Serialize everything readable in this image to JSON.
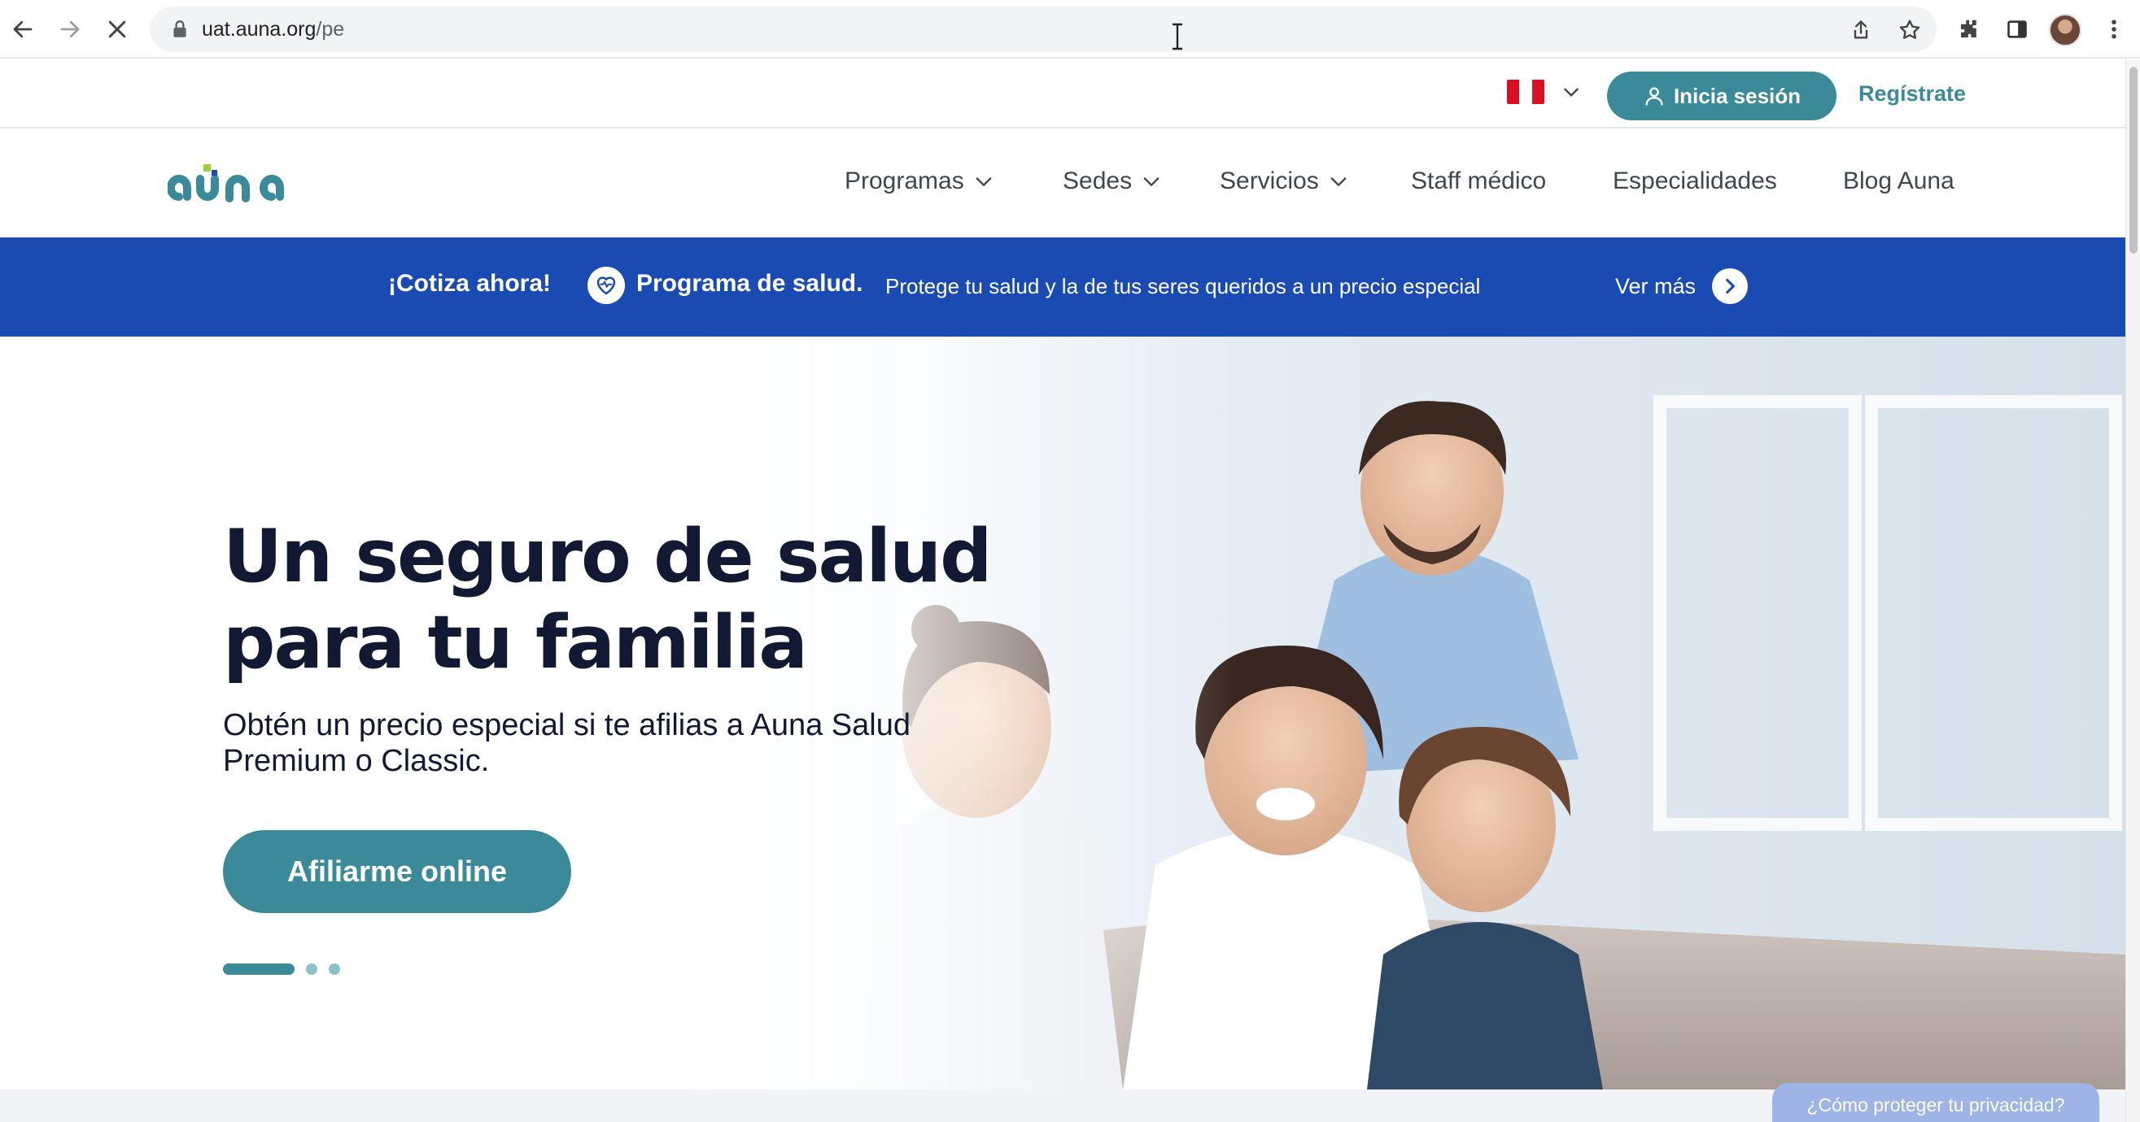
{
  "browser": {
    "url_host": "uat.auna.org",
    "url_path": "/pe"
  },
  "utility": {
    "country": "Perú",
    "login_label": "Inicia sesión",
    "register_label": "Regístrate"
  },
  "nav": {
    "items": [
      {
        "label": "Programas",
        "dropdown": true
      },
      {
        "label": "Sedes",
        "dropdown": true
      },
      {
        "label": "Servicios",
        "dropdown": true
      },
      {
        "label": "Staff médico",
        "dropdown": false
      },
      {
        "label": "Especialidades",
        "dropdown": false
      },
      {
        "label": "Blog Auna",
        "dropdown": false
      }
    ]
  },
  "banner": {
    "cotiza": "¡Cotiza ahora!",
    "program": "Programa de salud.",
    "text": "Protege tu salud y la de tus seres queridos a un precio especial",
    "link": "Ver más"
  },
  "hero": {
    "title_line1": "Un seguro de salud",
    "title_line2": "para tu familia",
    "subtitle_line1": "Obtén un precio especial si te afilias a Auna Salud",
    "subtitle_line2": "Premium o Classic.",
    "cta": "Afiliarme online",
    "slides": 3,
    "active_slide": 1
  },
  "privacy_tab": "¿Cómo proteger tu privacidad?",
  "colors": {
    "brand_teal": "#3b8a9a",
    "banner_blue": "#1a4bb3",
    "title_navy": "#121a33",
    "logo_green": "#9ccf3a"
  },
  "icons": {
    "back": "arrow-left-icon",
    "forward": "arrow-right-icon",
    "stop": "close-icon",
    "lock": "lock-icon",
    "share": "share-icon",
    "bookmark": "star-icon",
    "extensions": "puzzle-icon",
    "sidepanel": "side-panel-icon",
    "menu": "kebab-menu-icon",
    "user": "user-icon",
    "heart": "heart-pulse-icon",
    "chevron": "chevron-down-icon"
  }
}
